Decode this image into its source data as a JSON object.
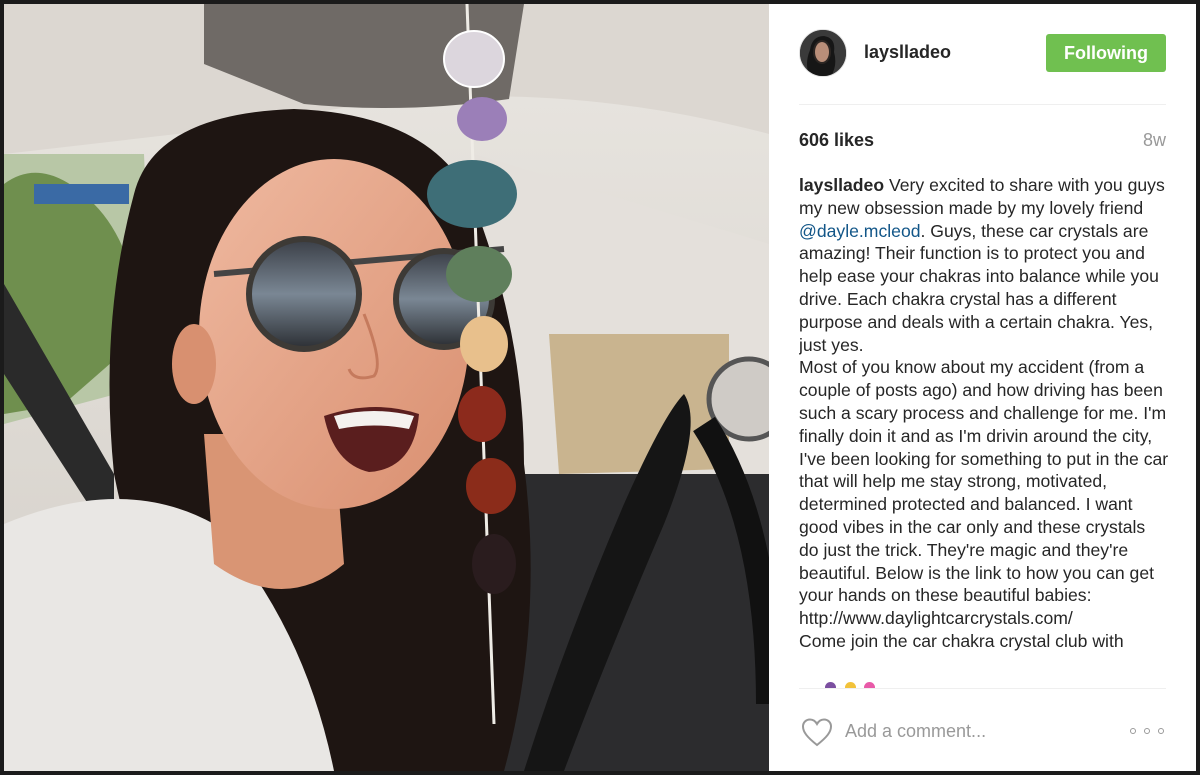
{
  "post": {
    "username": "layslladeo",
    "follow_label": "Following",
    "likes": "606 likes",
    "time_ago": "8w",
    "caption": {
      "username": "layslladeo",
      "text_1": "Very excited to share with you guys my new obsession made by my lovely friend",
      "mention": "@dayle.mcleod",
      "text_2": ". Guys, these car crystals are amazing! Their function is to protect you and help ease your chakras into balance while you drive. Each chakra crystal has a different purpose and deals with a certain chakra. Yes, just yes.",
      "paragraph_2": "Most of you know about my accident (from a couple of posts ago) and how driving has been such a scary process and challenge for me. I'm finally doin it and as I'm drivin around the city, I've been looking for something to put in the car that will help me stay strong, motivated, determined protected and balanced. I want good vibes in the car only and these crystals do just the trick. They're magic and they're beautiful. Below is the link to how you can get your hands on these beautiful babies:",
      "link": "http://www.daylightcarcrystals.com/",
      "paragraph_3": "Come join the car chakra crystal club with"
    },
    "comment_placeholder": "Add a comment..."
  },
  "icons": {
    "like": "heart-outline-icon",
    "more": "ellipsis-icon"
  },
  "colors": {
    "follow_button": "#70c050",
    "mention": "#125688",
    "muted_text": "#999999",
    "text": "#262626"
  }
}
